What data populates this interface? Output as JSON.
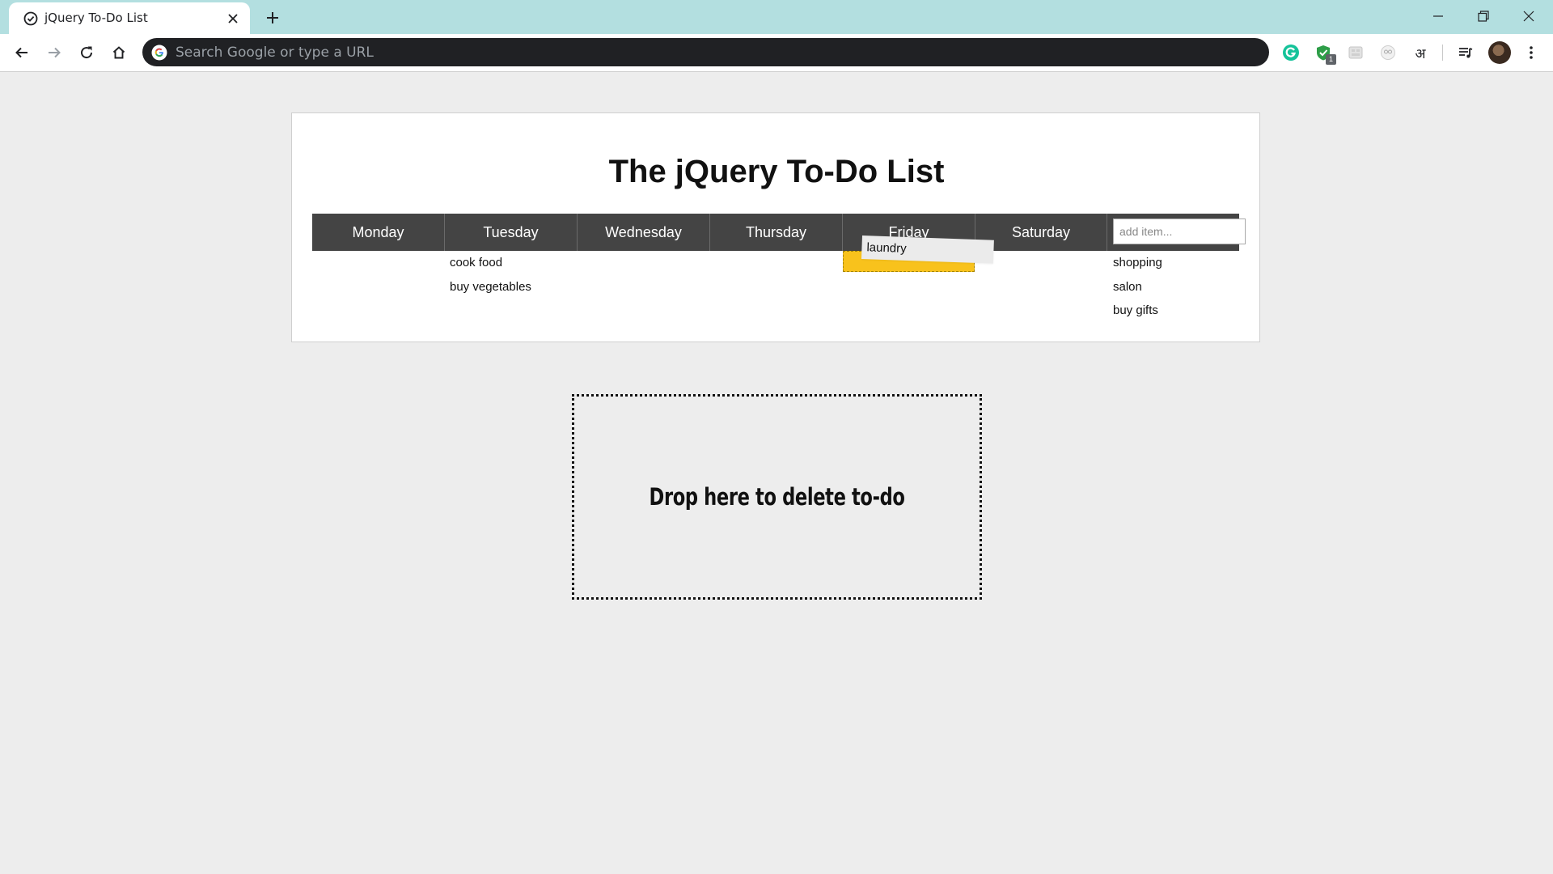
{
  "browser": {
    "tab": {
      "title": "jQuery To-Do List"
    },
    "omnibox": {
      "placeholder": "Search Google or type a URL"
    },
    "extensions": {
      "badge_count": "1",
      "devanagari_label": "अ"
    }
  },
  "page": {
    "title": "The jQuery To-Do List",
    "days": [
      "Monday",
      "Tuesday",
      "Wednesday",
      "Thursday",
      "Friday",
      "Saturday"
    ],
    "add_item_placeholder": "add item...",
    "todos": {
      "tuesday": [
        "cook food",
        "buy vegetables"
      ],
      "sunday": [
        "shopping",
        "salon",
        "buy gifts"
      ]
    },
    "dragging_item": "laundry",
    "trash_label": "Drop here to delete to-do"
  },
  "colors": {
    "tabstrip": "#b3dfe0",
    "day_header": "#444444",
    "drop_placeholder": "#f8c21c",
    "page_background": "#ededed"
  }
}
